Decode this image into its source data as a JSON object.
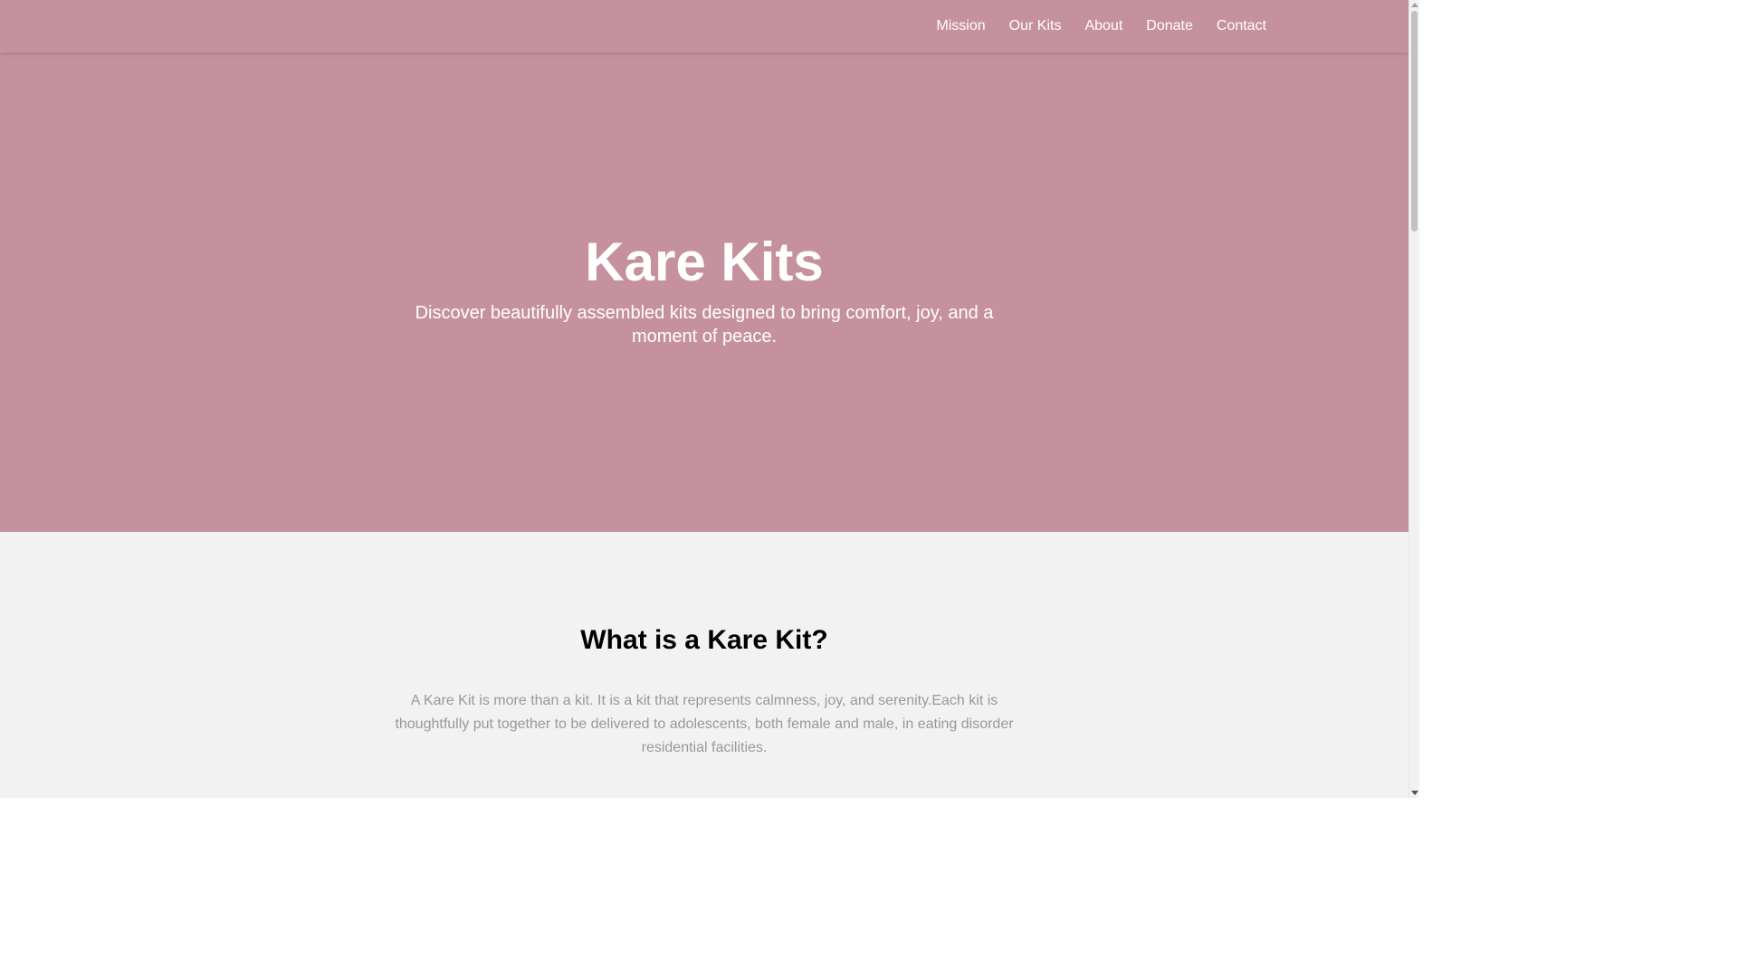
{
  "nav": {
    "items": [
      "Mission",
      "Our Kits",
      "About",
      "Donate",
      "Contact"
    ]
  },
  "hero": {
    "title": "Kare Kits",
    "subtitle": "Discover beautifully assembled kits designed to bring comfort, joy, and a moment of peace."
  },
  "intro": {
    "title": "What is a Kare Kit?",
    "body": "A Kare Kit is more than a kit. It is a kit that represents calmness, joy, and serenity.Each kit is thoughtfully put together to be delivered to adolescents, both female and male, in eating disorder residential facilities."
  },
  "colors": {
    "brand_pink": "#c6919e",
    "section_bg": "#f2f2f2",
    "body_text": "#999999"
  },
  "icons": {
    "scroll_up": "triangle-up",
    "scroll_down": "triangle-down"
  }
}
